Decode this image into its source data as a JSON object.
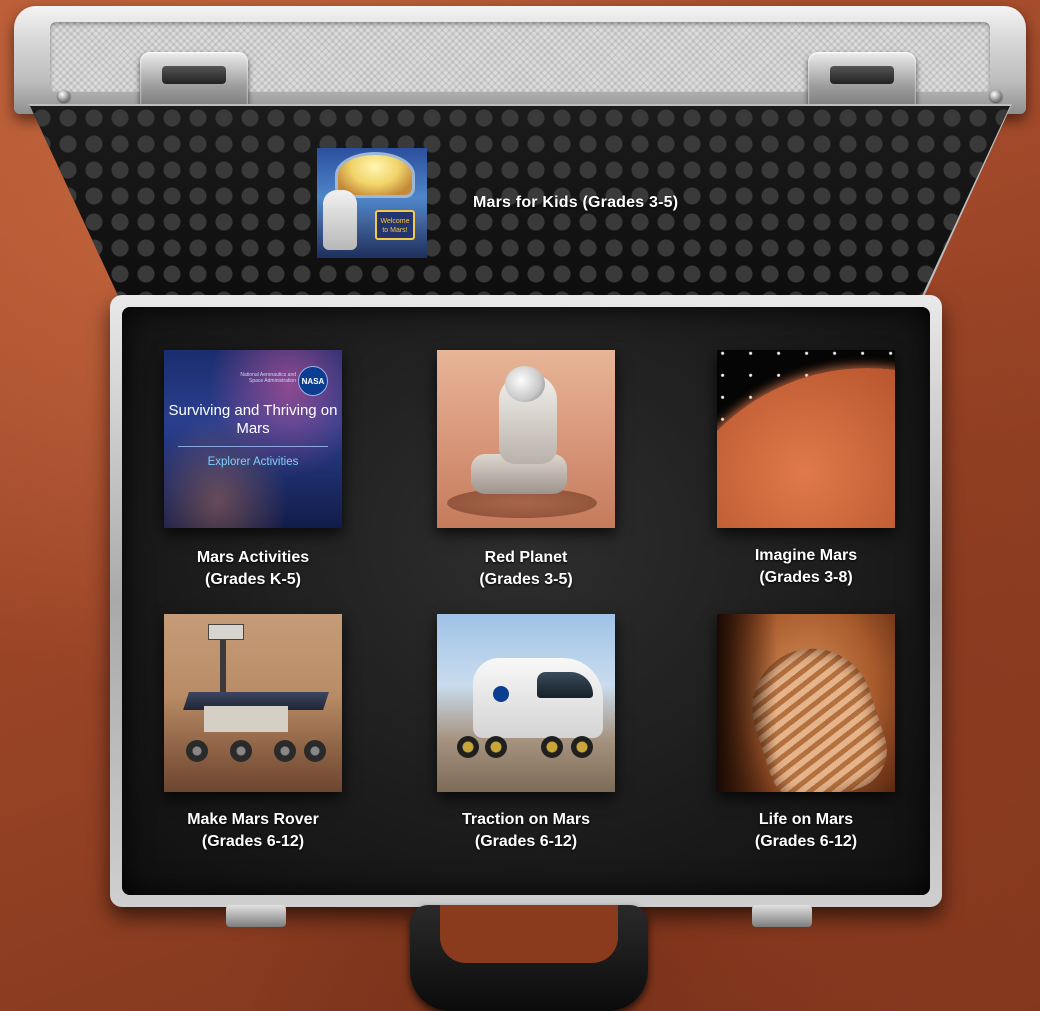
{
  "lid": {
    "featured": {
      "title": "Mars for Kids (Grades 3-5)",
      "thumb_sign": "Welcome to Mars!"
    }
  },
  "activities": [
    {
      "title_line1": "Mars Activities",
      "title_line2": "(Grades K-5)",
      "poster": {
        "agency": "National Aeronautics and Space Administration",
        "badge": "NASA",
        "heading": "Surviving and Thriving on Mars",
        "subheading": "Explorer Activities"
      }
    },
    {
      "title_line1": "Red Planet",
      "title_line2": "(Grades 3-5)"
    },
    {
      "title_line1": "Imagine Mars",
      "title_line2": "(Grades 3-8)"
    },
    {
      "title_line1": "Make Mars Rover",
      "title_line2": "(Grades 6-12)"
    },
    {
      "title_line1": "Traction on Mars",
      "title_line2": "(Grades 6-12)"
    },
    {
      "title_line1": "Life on Mars",
      "title_line2": "(Grades 6-12)"
    }
  ]
}
